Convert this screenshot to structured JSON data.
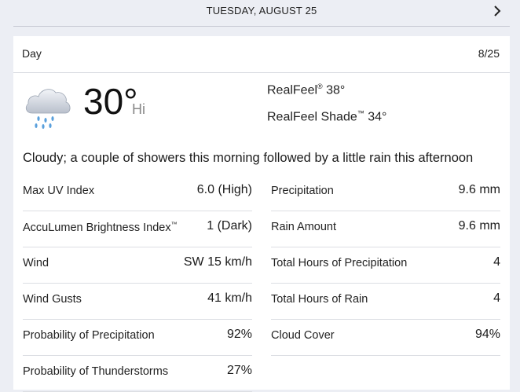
{
  "nav": {
    "date": "TUESDAY, AUGUST 25"
  },
  "card": {
    "title": "Day",
    "short_date": "8/25",
    "temperature": "30°",
    "hilo": "Hi",
    "realfeel_label": "RealFeel",
    "realfeel_mark": "®",
    "realfeel_value": "38°",
    "realfeel_shade_label": "RealFeel Shade",
    "realfeel_shade_mark": "™",
    "realfeel_shade_value": "34°",
    "phrase": "Cloudy; a couple of showers this morning followed by a little rain this afternoon"
  },
  "left_rows": [
    {
      "label": "Max UV Index",
      "value": "6.0 (High)"
    },
    {
      "label": "AccuLumen Brightness Index",
      "mark": "™",
      "value": "1 (Dark)"
    },
    {
      "label": "Wind",
      "value": "SW 15 km/h"
    },
    {
      "label": "Wind Gusts",
      "value": "41 km/h"
    },
    {
      "label": "Probability of Precipitation",
      "value": "92%"
    },
    {
      "label": "Probability of Thunderstorms",
      "value": "27%"
    }
  ],
  "right_rows": [
    {
      "label": "Precipitation",
      "value": "9.6 mm"
    },
    {
      "label": "Rain Amount",
      "value": "9.6 mm"
    },
    {
      "label": "Total Hours of Precipitation",
      "value": "4"
    },
    {
      "label": "Total Hours of Rain",
      "value": "4"
    },
    {
      "label": "Cloud Cover",
      "value": "94%"
    }
  ],
  "icons": {
    "next": "chevron-right-icon",
    "weather": "cloud-rain-icon"
  }
}
